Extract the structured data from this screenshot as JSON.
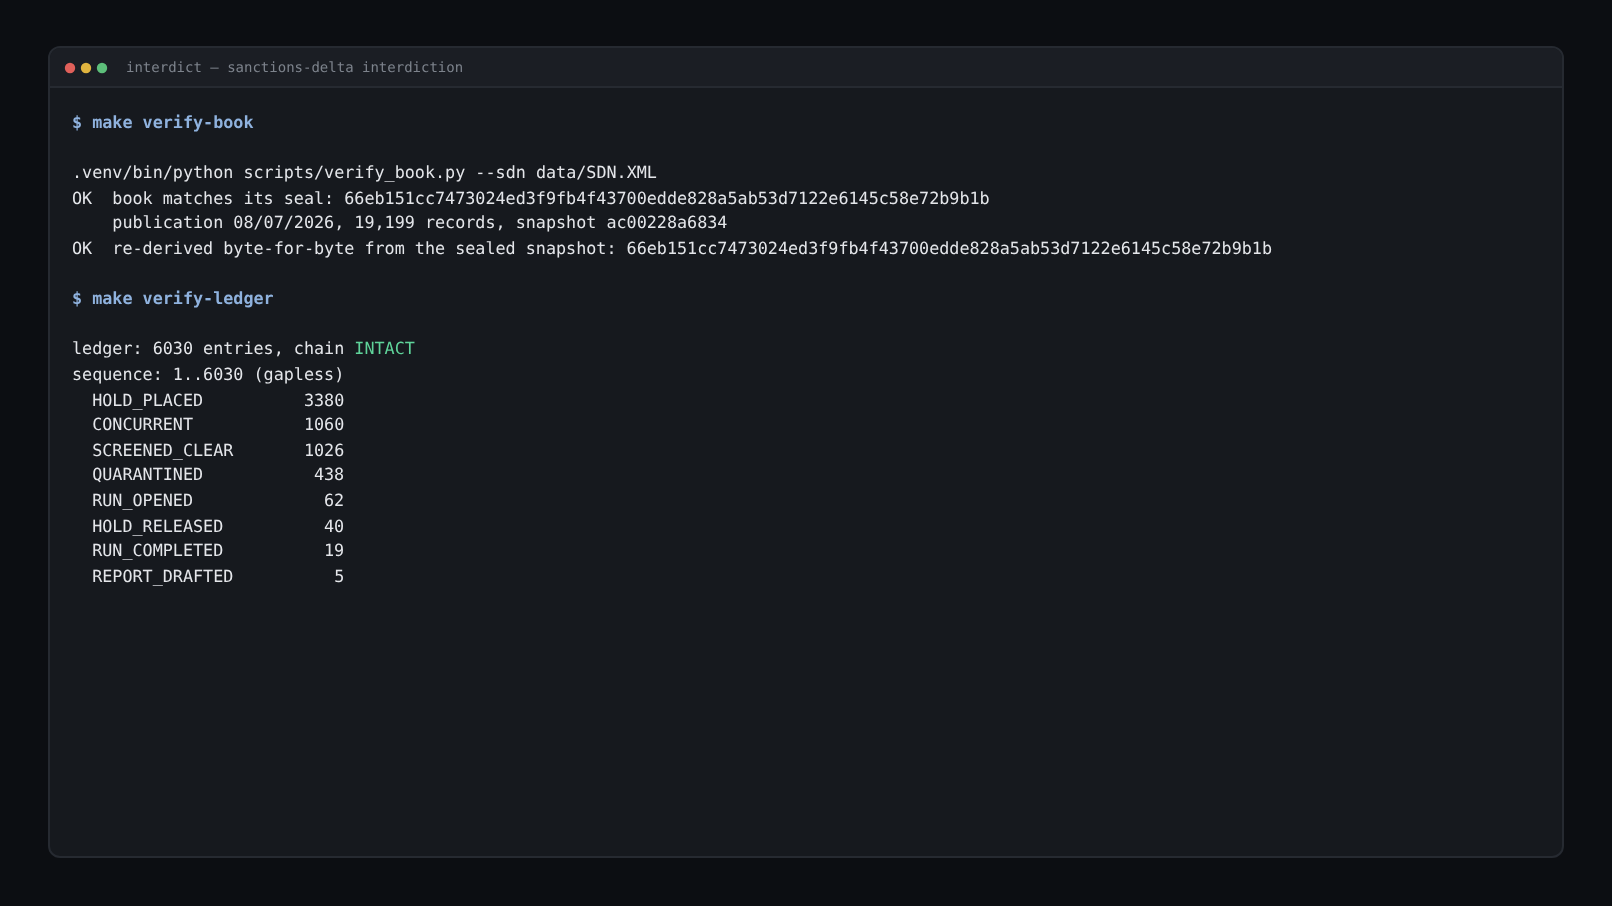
{
  "window": {
    "title": "interdict — sanctions-delta interdiction"
  },
  "sections": [
    {
      "prompt": "$",
      "command": "make verify-book",
      "output": [
        {
          "kind": "plain",
          "text": ".venv/bin/python scripts/verify_book.py --sdn data/SDN.XML"
        },
        {
          "kind": "status",
          "status": "OK",
          "text": "book matches its seal: 66eb151cc7473024ed3f9fb4f43700edde828a5ab53d7122e6145c58e72b9b1b"
        },
        {
          "kind": "continuation",
          "text": "publication 08/07/2026, 19,199 records, snapshot ac00228a6834"
        },
        {
          "kind": "status",
          "status": "OK",
          "text": "re-derived byte-for-byte from the sealed snapshot: 66eb151cc7473024ed3f9fb4f43700edde828a5ab53d7122e6145c58e72b9b1b"
        }
      ]
    },
    {
      "prompt": "$",
      "command": "make verify-ledger",
      "output": [
        {
          "kind": "highlight",
          "text": "ledger: 6030 entries, chain",
          "highlight": "INTACT"
        },
        {
          "kind": "plain",
          "text": "sequence: 1..6030 (gapless)"
        },
        {
          "kind": "count",
          "label": "HOLD_PLACED",
          "value": "3380"
        },
        {
          "kind": "count",
          "label": "CONCURRENT",
          "value": "1060"
        },
        {
          "kind": "count",
          "label": "SCREENED_CLEAR",
          "value": "1026"
        },
        {
          "kind": "count",
          "label": "QUARANTINED",
          "value": "438"
        },
        {
          "kind": "count",
          "label": "RUN_OPENED",
          "value": "62"
        },
        {
          "kind": "count",
          "label": "HOLD_RELEASED",
          "value": "40"
        },
        {
          "kind": "count",
          "label": "RUN_COMPLETED",
          "value": "19"
        },
        {
          "kind": "count",
          "label": "REPORT_DRAFTED",
          "value": "5"
        }
      ]
    }
  ]
}
